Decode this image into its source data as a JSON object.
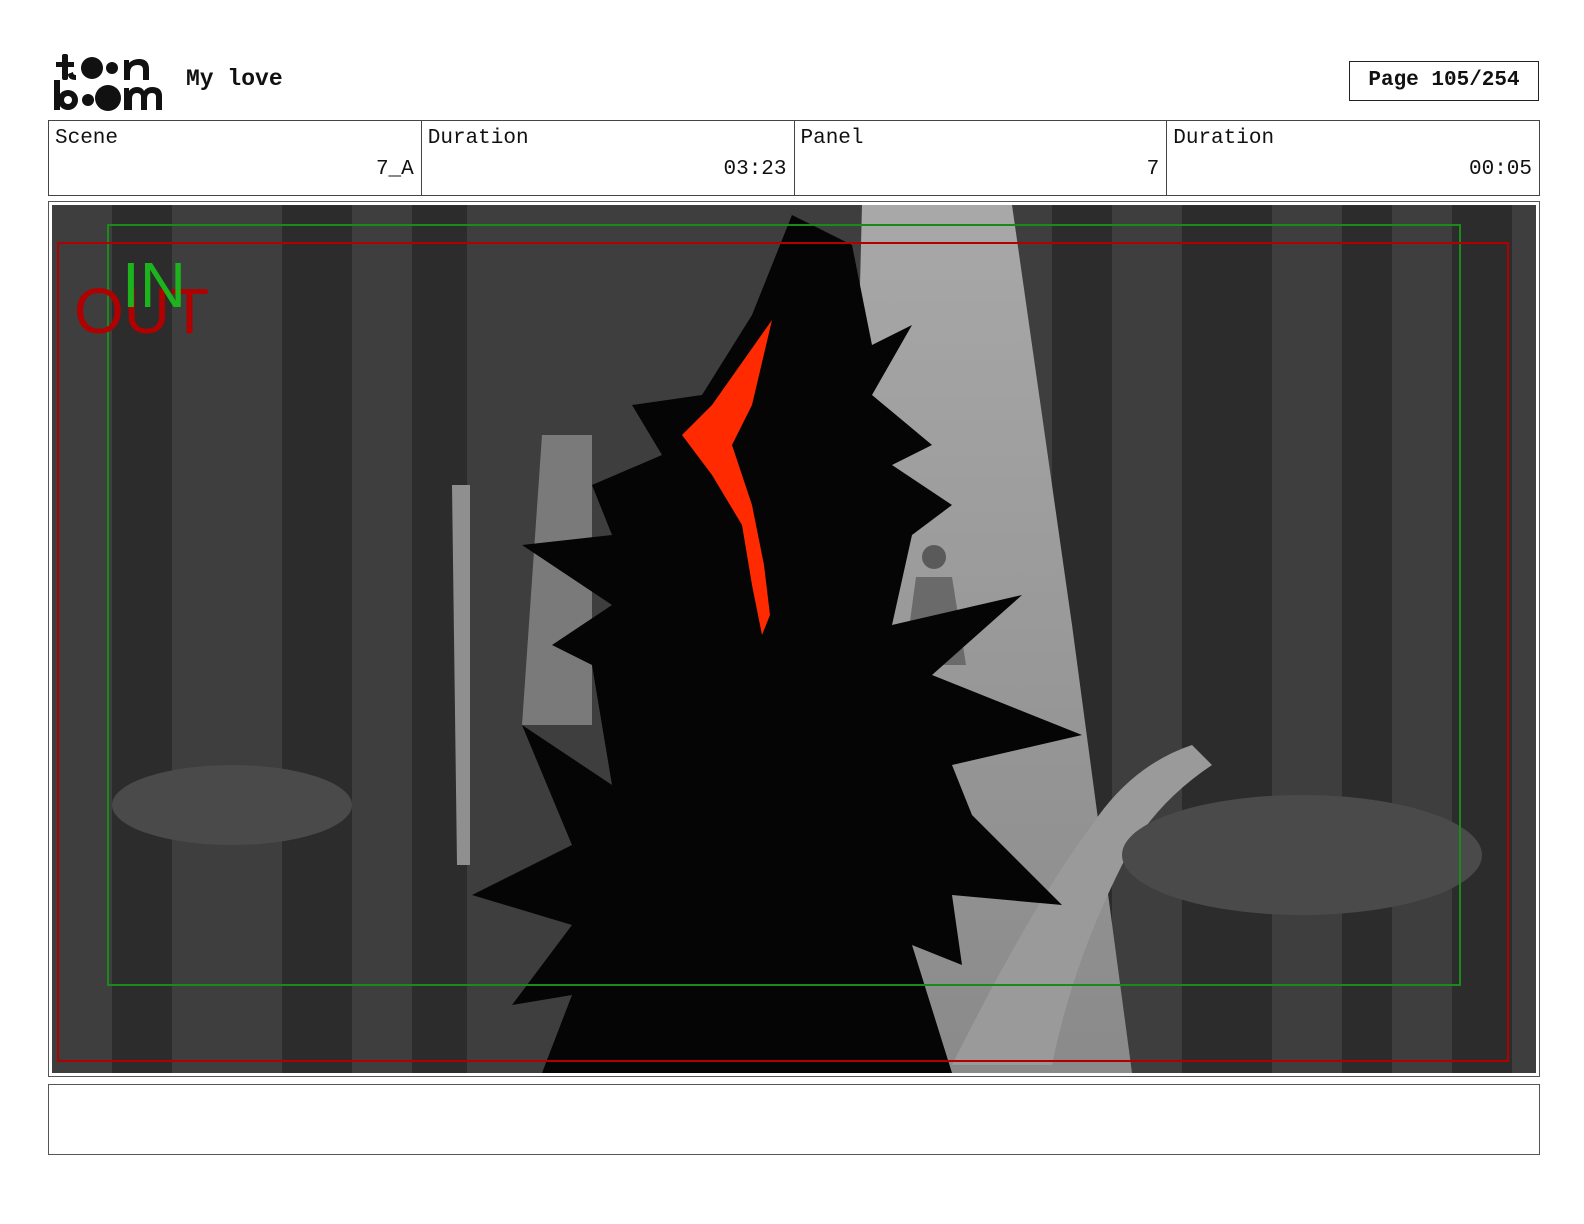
{
  "header": {
    "project_title": "My love",
    "page_label": "Page 105/254"
  },
  "info": {
    "scene_label": "Scene",
    "scene_value": "7_A",
    "scene_duration_label": "Duration",
    "scene_duration_value": "03:23",
    "panel_label": "Panel",
    "panel_value": "7",
    "panel_duration_label": "Duration",
    "panel_duration_value": "00:05"
  },
  "panel": {
    "in_label": "IN",
    "out_label": "OUT",
    "in_color": "#1db31d",
    "out_color": "#b00000",
    "accent_red": "#ff2a00"
  },
  "notes": {
    "text": ""
  }
}
